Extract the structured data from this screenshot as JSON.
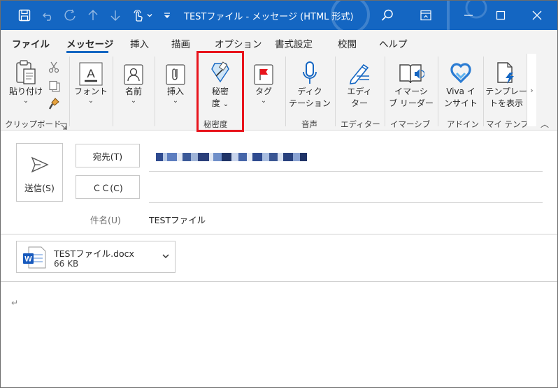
{
  "window": {
    "title": "TESTファイル  -  メッセージ (HTML 形式)"
  },
  "menu_tabs": [
    {
      "label": "ファイル",
      "bold": true
    },
    {
      "label": "メッセージ",
      "bold": true,
      "active": true
    },
    {
      "label": "挿入"
    },
    {
      "label": "描画"
    },
    {
      "label": "オプション"
    },
    {
      "label": "書式設定"
    },
    {
      "label": "校閲"
    },
    {
      "label": "ヘルプ"
    }
  ],
  "ribbon": {
    "clipboard": {
      "paste_line1": "貼り付け",
      "paste_line2": "⌄",
      "group": "クリップボード"
    },
    "font": {
      "label": "フォント"
    },
    "name": {
      "label": "名前"
    },
    "insert": {
      "label": "挿入"
    },
    "sensitivity": {
      "line1": "秘密",
      "line2": "度",
      "group": "秘密度"
    },
    "tags": {
      "label": "タグ"
    },
    "dictate": {
      "line1": "ディク",
      "line2": "テーション",
      "group": "音声"
    },
    "editor": {
      "line1": "エディ",
      "line2": "ター",
      "group": "エディター"
    },
    "immersive": {
      "line1": "イマーシ",
      "line2": "ブ リーダー",
      "group": "イマーシブ"
    },
    "viva": {
      "line1": "Viva イ",
      "line2": "ンサイト",
      "group": "アドイン"
    },
    "templates": {
      "line1": "テンプレー",
      "line2": "トを表示",
      "group": "マイ テンプ"
    }
  },
  "compose": {
    "send_label": "送信(S)",
    "to_label": "宛先(T)",
    "cc_label": "ＣＣ(C)",
    "subject_label": "件名(U)",
    "subject_value": "TESTファイル"
  },
  "attachment": {
    "name": "TESTファイル.docx",
    "size": "66 KB"
  },
  "body": {
    "paragraph_mark": "↵"
  },
  "colors": {
    "titlebar": "#1466c2",
    "highlight": "#e8141c",
    "word_blue": "#185abd"
  }
}
